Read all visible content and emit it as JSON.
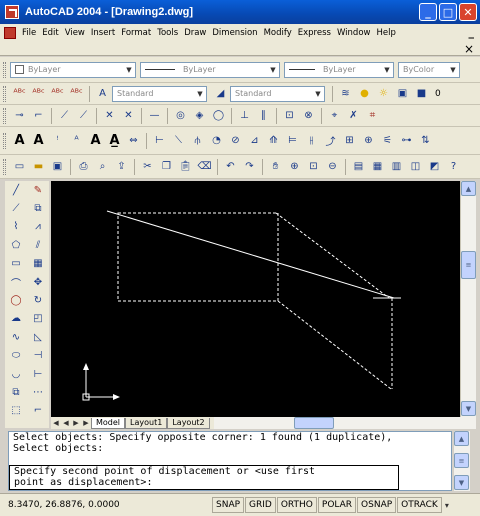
{
  "window": {
    "title": "AutoCAD 2004 - [Drawing2.dwg]"
  },
  "menu": [
    "File",
    "Edit",
    "View",
    "Insert",
    "Format",
    "Tools",
    "Draw",
    "Dimension",
    "Modify",
    "Express",
    "Window",
    "Help"
  ],
  "properties": {
    "layer": "ByLayer",
    "linetype": "ByLayer",
    "lineweight": "ByLayer",
    "color": "ByColor"
  },
  "styles": {
    "text_style": "Standard",
    "dim_style": "Standard",
    "layer_value": "0"
  },
  "tabs": {
    "model": "Model",
    "layout1": "Layout1",
    "layout2": "Layout2"
  },
  "command": {
    "line1": "Select objects: Specify opposite corner: 1 found (1 duplicate),",
    "line2": "Select objects:",
    "line3": "Specify second point of displacement or <use first",
    "line4": "point as displacement>:"
  },
  "status": {
    "coords": "8.3470, 26.8876, 0.0000",
    "toggles": [
      "SNAP",
      "GRID",
      "ORTHO",
      "POLAR",
      "OSNAP",
      "OTRACK"
    ]
  },
  "colors": {
    "titlebar": "#0a5fd8",
    "canvas": "#000000",
    "drawing_lines": "#ffffff"
  },
  "icons": [
    "app-icon",
    "minimize-icon",
    "maximize-icon",
    "close-icon",
    "layers-icon",
    "bulb-icon",
    "line-icon",
    "circle-icon",
    "arc-icon",
    "text-icon",
    "ucs-icon"
  ]
}
